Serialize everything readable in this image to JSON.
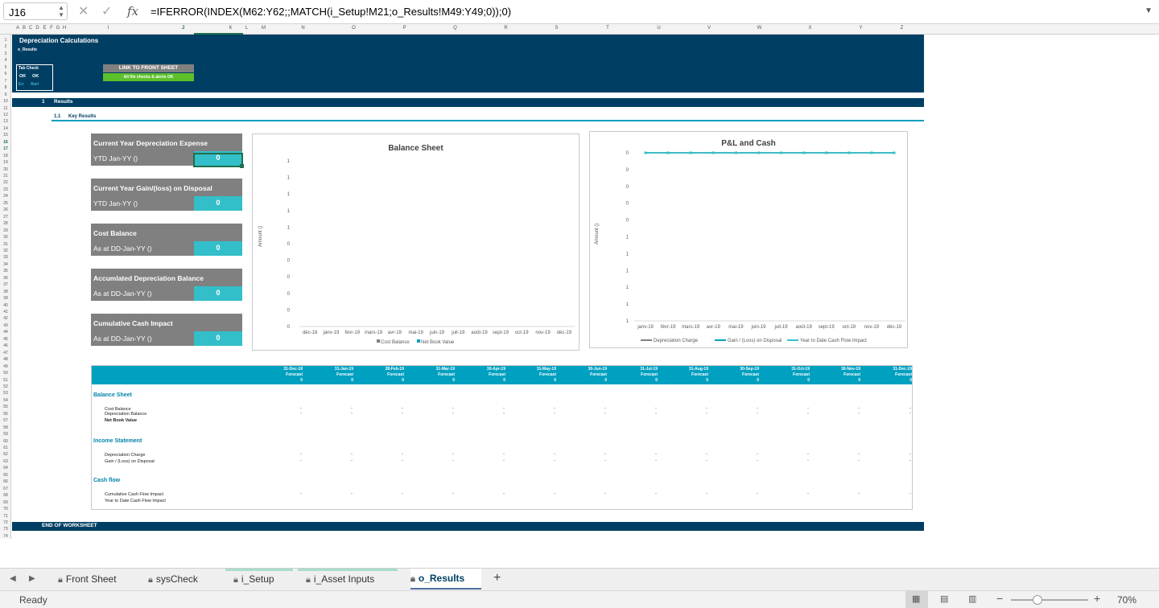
{
  "formula_bar": {
    "cell_ref": "J16",
    "fx": "fx",
    "formula": "=IFERROR(INDEX(M62:Y62;;MATCH(i_Setup!M21;o_Results!M49:Y49;0));0)"
  },
  "col_headers": [
    "A",
    "B",
    "C",
    "D",
    "E",
    "F",
    "G",
    "H",
    "I",
    "J",
    "K",
    "L",
    "M",
    "N",
    "O",
    "P",
    "Q",
    "R",
    "S",
    "T",
    "U",
    "V",
    "W",
    "X",
    "Y",
    "Z"
  ],
  "row_headers": [
    "1",
    "2",
    "3",
    "4",
    "5",
    "6",
    "7",
    "8",
    "9",
    "10",
    "11",
    "12",
    "13",
    "14",
    "15",
    "16",
    "17",
    "18",
    "19",
    "20",
    "21",
    "22",
    "23",
    "24",
    "25",
    "26",
    "27",
    "28",
    "29",
    "30",
    "31",
    "32",
    "33",
    "34",
    "35",
    "36",
    "37",
    "38",
    "39",
    "40",
    "41",
    "42",
    "43",
    "44",
    "45",
    "46",
    "47",
    "48",
    "49",
    "50",
    "51",
    "52",
    "53",
    "54",
    "55",
    "56",
    "57",
    "58",
    "59",
    "60",
    "61",
    "62",
    "63",
    "64",
    "65",
    "66",
    "67",
    "68",
    "69",
    "70",
    "71",
    "72",
    "73",
    "74"
  ],
  "header": {
    "title": "Depreciation Calculations",
    "subtitle": "o_Results",
    "tab_check": "Tab Check",
    "ok1": "OK",
    "ok2": "OK",
    "err": "Err",
    "alert": "Alert",
    "link_button": "LINK TO FRONT SHEET",
    "status": "All file checks & alerts OK"
  },
  "sections": {
    "results_num": "1",
    "results": "Results",
    "key_num": "1.1",
    "key": "Key Results",
    "end": "END OF WORKSHEET"
  },
  "kpis": [
    {
      "title": "Current Year Depreciation Expense",
      "sub": "YTD Jan-YY ()",
      "value": "0"
    },
    {
      "title": "Current Year Gain/(loss) on Disposal",
      "sub": "YTD Jan-YY ()",
      "value": "0"
    },
    {
      "title": "Cost Balance",
      "sub": "As at DD-Jan-YY ()",
      "value": "0"
    },
    {
      "title": "Accumlated Depreciation Balance",
      "sub": "As at DD-Jan-YY ()",
      "value": "0"
    },
    {
      "title": "Cumulative Cash Impact",
      "sub": "As at DD-Jan-YY ()",
      "value": "0"
    }
  ],
  "chart_data": [
    {
      "type": "line",
      "title": "Balance Sheet",
      "ylabel": "Amount ()",
      "xlabel": "",
      "categories": [
        "déc-18",
        "janv-19",
        "févr-19",
        "mars-19",
        "avr-19",
        "mai-19",
        "juin-19",
        "juil-19",
        "août-19",
        "sept-19",
        "oct-19",
        "nov-19",
        "déc-19"
      ],
      "y_tick_labels": [
        "1",
        "1",
        "1",
        "1",
        "1",
        "0",
        "0",
        "0",
        "0",
        "0",
        "0"
      ],
      "series": [
        {
          "name": "Cost Balance",
          "values": [
            0,
            0,
            0,
            0,
            0,
            0,
            0,
            0,
            0,
            0,
            0,
            0,
            0
          ]
        },
        {
          "name": "Net Book Value",
          "values": [
            0,
            0,
            0,
            0,
            0,
            0,
            0,
            0,
            0,
            0,
            0,
            0,
            0
          ]
        }
      ],
      "legend": "bottom"
    },
    {
      "type": "line",
      "title": "P&L and Cash",
      "ylabel": "Amount ()",
      "xlabel": "",
      "categories": [
        "janv-19",
        "févr-19",
        "mars-19",
        "avr-19",
        "mai-19",
        "juin-19",
        "juil-19",
        "août-19",
        "sept-19",
        "oct-19",
        "nov-19",
        "déc-19"
      ],
      "y_tick_labels": [
        "0",
        "0",
        "0",
        "0",
        "0",
        "1",
        "1",
        "1",
        "1",
        "1",
        "1"
      ],
      "series": [
        {
          "name": "Depreciation Charge",
          "values": [
            0,
            0,
            0,
            0,
            0,
            0,
            0,
            0,
            0,
            0,
            0,
            0
          ]
        },
        {
          "name": "Gain / (Loss) on Disposal",
          "values": [
            0,
            0,
            0,
            0,
            0,
            0,
            0,
            0,
            0,
            0,
            0,
            0
          ]
        },
        {
          "name": "Year to Date Cash Flow Impact",
          "values": [
            0,
            0,
            0,
            0,
            0,
            0,
            0,
            0,
            0,
            0,
            0,
            0
          ]
        }
      ],
      "legend": "bottom"
    }
  ],
  "table": {
    "dates": [
      "31-Dec-18",
      "31-Jan-19",
      "28-Feb-19",
      "31-Mar-19",
      "30-Apr-19",
      "31-May-19",
      "30-Jun-19",
      "31-Jul-19",
      "31-Aug-19",
      "30-Sep-19",
      "31-Oct-19",
      "30-Nov-19",
      "31-Dec-19"
    ],
    "type_label": "Forecast",
    "zero": "0",
    "dash": "-",
    "sections": [
      {
        "title": "Balance Sheet",
        "rows": [
          "Cost Balance",
          "Depreciation Balance",
          "Net Book Value"
        ]
      },
      {
        "title": "Income Statement",
        "rows": [
          "Depreciation Charge",
          "Gain / (Loss) on Disposal"
        ]
      },
      {
        "title": "Cash flow",
        "rows": [
          "Cumulative Cash Flow Impact",
          "Year to Date Cash Flow Impact"
        ]
      }
    ]
  },
  "sheet_tabs": [
    "Front Sheet",
    "sysCheck",
    "i_Setup",
    "i_Asset Inputs",
    "o_Results"
  ],
  "active_tab": "o_Results",
  "status": {
    "ready": "Ready",
    "zoom": "70%"
  },
  "colors": {
    "navy": "#003f63",
    "teal": "#33bfc9",
    "table_header": "#00a0c0",
    "kpi_grey": "#808080",
    "green": "#5cc12b"
  }
}
